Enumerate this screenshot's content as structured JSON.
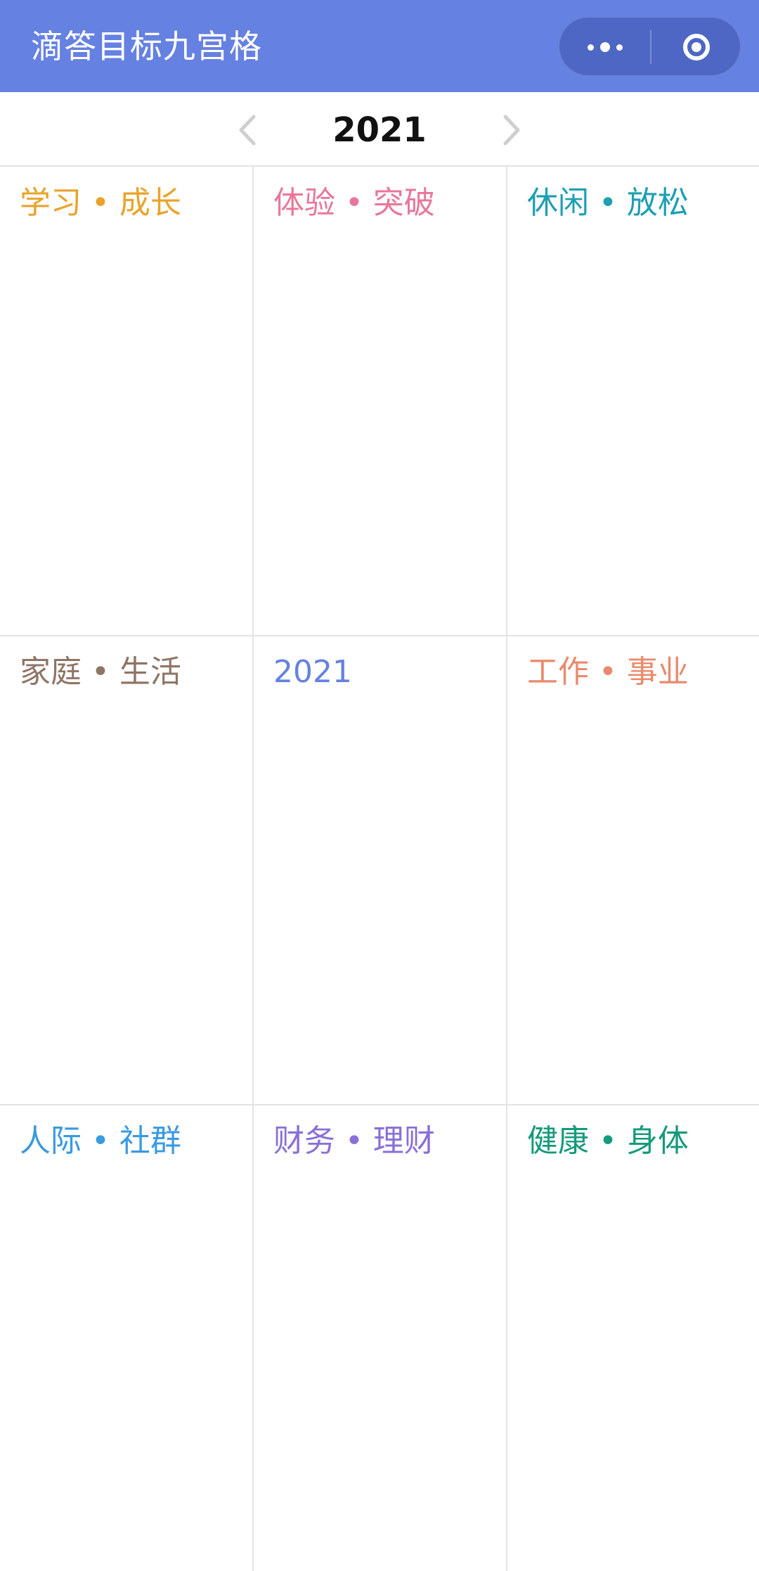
{
  "header": {
    "title": "滴答目标九宫格",
    "background": "#6581e1",
    "more_icon": "more-dots-icon",
    "close_icon": "target-ring-icon"
  },
  "year_selector": {
    "year": "2021",
    "prev_icon": "chevron-left-icon",
    "next_icon": "chevron-right-icon"
  },
  "grid": {
    "cells": [
      {
        "label": "学习 • 成长",
        "color": "#e9a32b"
      },
      {
        "label": "体验 • 突破",
        "color": "#e8789a"
      },
      {
        "label": "休闲 • 放松",
        "color": "#1f9fb3"
      },
      {
        "label": "家庭 • 生活",
        "color": "#8e7565"
      },
      {
        "label": "2021",
        "color": "#6581e1"
      },
      {
        "label": "工作 • 事业",
        "color": "#ea8a6c"
      },
      {
        "label": "人际 • 社群",
        "color": "#3a9ae0"
      },
      {
        "label": "财务 • 理财",
        "color": "#8a6fd8"
      },
      {
        "label": "健康 • 身体",
        "color": "#149a7c"
      }
    ]
  }
}
